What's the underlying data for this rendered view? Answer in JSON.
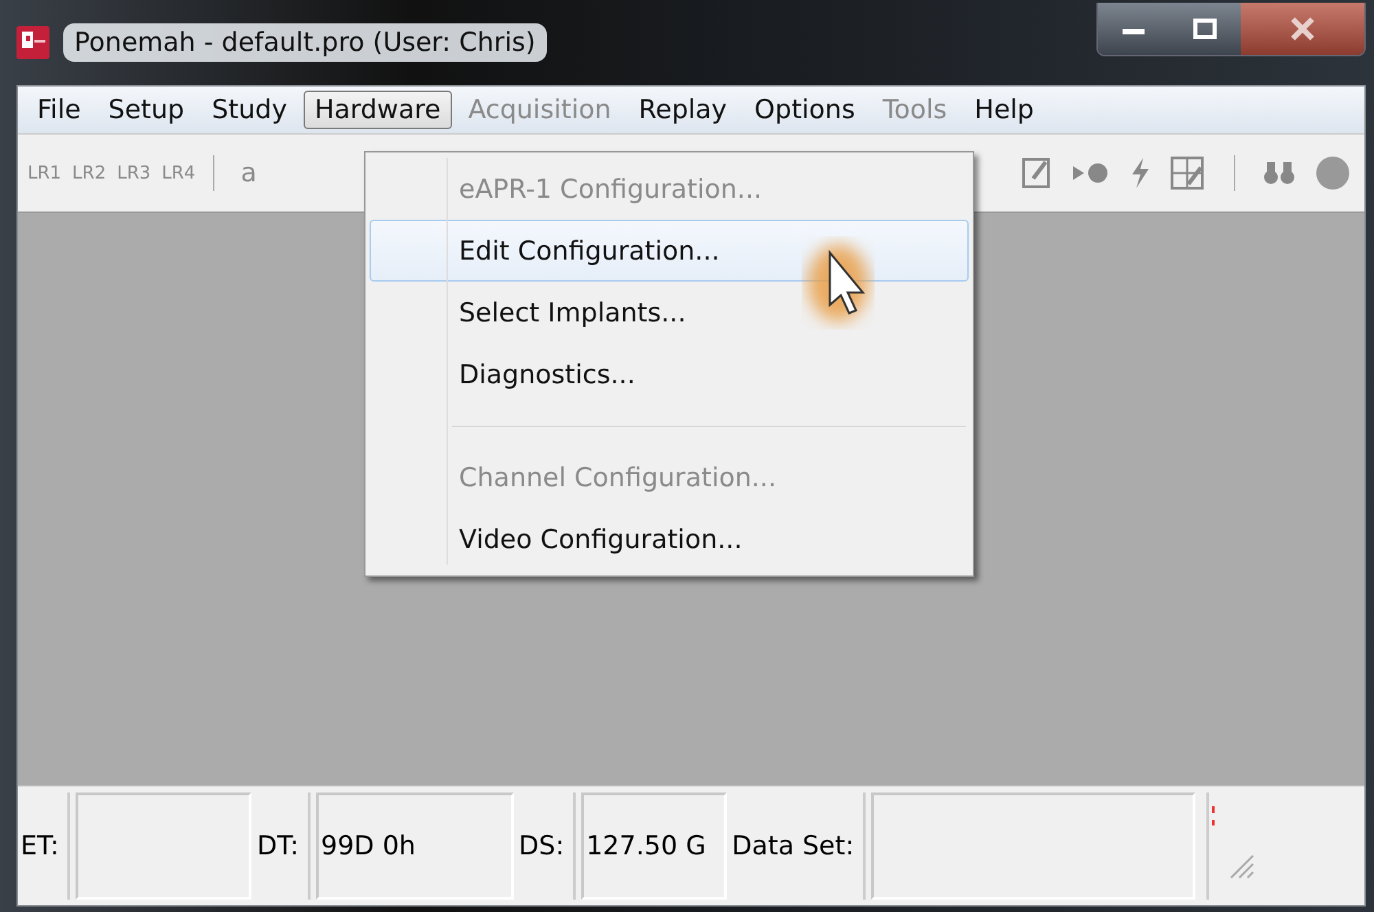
{
  "window": {
    "title": "Ponemah - default.pro (User: Chris)"
  },
  "menu_bar": [
    {
      "label": "File",
      "disabled": false,
      "selected": false
    },
    {
      "label": "Setup",
      "disabled": false,
      "selected": false
    },
    {
      "label": "Study",
      "disabled": false,
      "selected": false
    },
    {
      "label": "Hardware",
      "disabled": false,
      "selected": true
    },
    {
      "label": "Acquisition",
      "disabled": true,
      "selected": false
    },
    {
      "label": "Replay",
      "disabled": false,
      "selected": false
    },
    {
      "label": "Options",
      "disabled": false,
      "selected": false
    },
    {
      "label": "Tools",
      "disabled": true,
      "selected": false
    },
    {
      "label": "Help",
      "disabled": false,
      "selected": false
    }
  ],
  "toolbar": {
    "buttons": [
      "LR1",
      "LR2",
      "LR3",
      "LR4"
    ],
    "text_button": "a"
  },
  "dropdown": {
    "items": [
      {
        "kind": "item",
        "label": "eAPR-1 Configuration...",
        "disabled": true,
        "selected": false
      },
      {
        "kind": "item",
        "label": "Edit Configuration...",
        "disabled": false,
        "selected": true
      },
      {
        "kind": "item",
        "label": "Select Implants...",
        "disabled": false,
        "selected": false
      },
      {
        "kind": "item",
        "label": "Diagnostics...",
        "disabled": false,
        "selected": false
      },
      {
        "kind": "separator"
      },
      {
        "kind": "item",
        "label": "Channel Configuration...",
        "disabled": true,
        "selected": false
      },
      {
        "kind": "item",
        "label": "Video Configuration...",
        "disabled": false,
        "selected": false
      }
    ]
  },
  "status_bar": [
    {
      "kind": "label",
      "text": "ET:"
    },
    {
      "kind": "field"
    },
    {
      "kind": "label",
      "text": "DT:"
    },
    {
      "kind": "field",
      "text": "99D 0h"
    },
    {
      "kind": "label",
      "text": "DS:"
    },
    {
      "kind": "field",
      "text": "127.50 G"
    },
    {
      "kind": "label",
      "text": "Data Set:"
    },
    {
      "kind": "field"
    }
  ]
}
